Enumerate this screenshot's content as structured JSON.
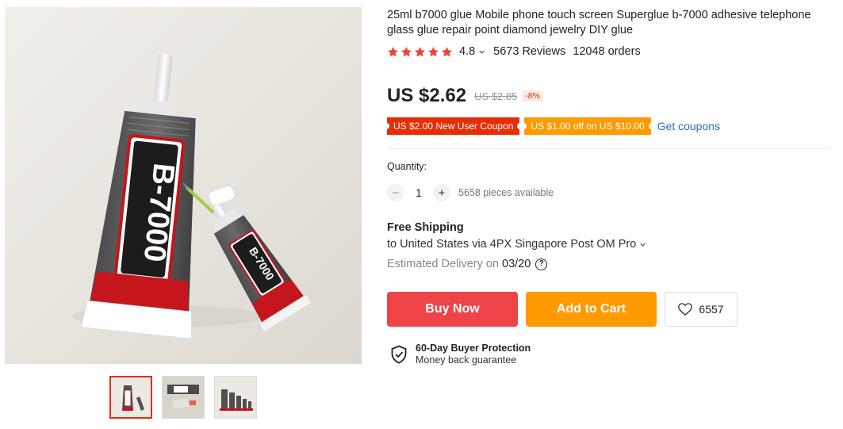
{
  "product": {
    "title": "25ml b7000 glue Mobile phone touch screen Superglue b-7000 adhesive telephone glass glue repair point diamond jewelry DIY glue",
    "rating": "4.8",
    "stars": 5,
    "reviews": "5673 Reviews",
    "orders": "12048 orders",
    "image_brand_text": "B-7000",
    "image_small_brand_text": "B-7000"
  },
  "price": {
    "current": "US $2.62",
    "original": "US $2.85",
    "discount": "-8%"
  },
  "coupons": {
    "items": [
      "US $2.00 New User Coupon",
      "US $1.00 off on US $10.00"
    ],
    "get_label": "Get coupons"
  },
  "quantity": {
    "label": "Quantity:",
    "value": "1",
    "minus": "−",
    "plus": "+",
    "available": "5658 pieces available"
  },
  "shipping": {
    "title": "Free Shipping",
    "to": "to United States via 4PX Singapore Post OM Pro",
    "delivery_label": "Estimated Delivery on",
    "delivery_date": "03/20",
    "help": "?"
  },
  "actions": {
    "buy": "Buy Now",
    "cart": "Add to Cart",
    "wishlist_count": "6557"
  },
  "protection": {
    "title": "60-Day Buyer Protection",
    "subtitle": "Money back guarantee"
  },
  "colors": {
    "accent_red": "#e62e04",
    "buy_button": "#ee4349",
    "cart_button": "#ff9a00",
    "star": "#f04438",
    "link": "#2a6ebb"
  }
}
